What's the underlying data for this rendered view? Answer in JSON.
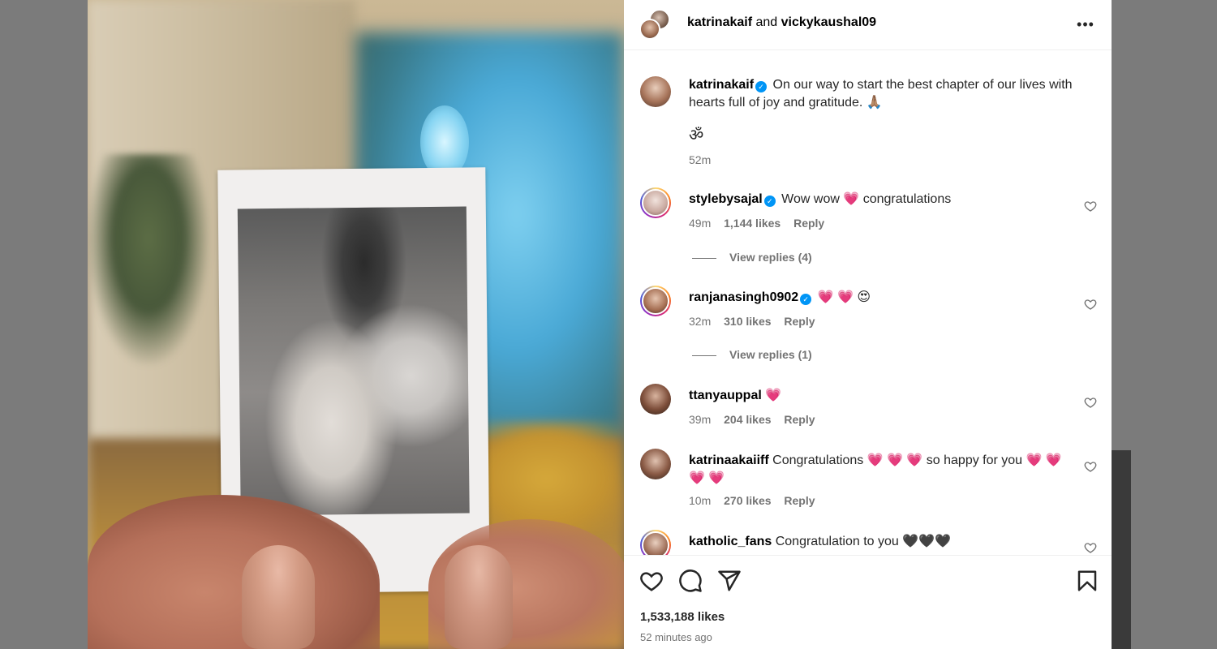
{
  "post": {
    "header": {
      "user1": "katrinakaif",
      "joiner": " and ",
      "user2": "vickykaushal09",
      "more": "•••"
    },
    "caption": {
      "user": "katrinakaif",
      "text": " On our way to start the best chapter of our lives with hearts full of joy and gratitude. 🙏🏽",
      "extra": "ॐ",
      "time": "52m"
    },
    "comments": [
      {
        "user": "stylebysajal",
        "verified": true,
        "text": " Wow wow 💗 congratulations",
        "time": "49m",
        "likes": "1,144 likes",
        "reply": "Reply",
        "view_replies": "View replies (4)"
      },
      {
        "user": "ranjanasingh0902",
        "verified": true,
        "text": " 💗 💗 😍",
        "time": "32m",
        "likes": "310 likes",
        "reply": "Reply",
        "view_replies": "View replies (1)"
      },
      {
        "user": "ttanyauppal",
        "verified": false,
        "text": " 💗",
        "time": "39m",
        "likes": "204 likes",
        "reply": "Reply"
      },
      {
        "user": "katrinaakaiiff",
        "verified": false,
        "text": " Congratulations 💗 💗 💗 so happy for you 💗 💗 💗 💗",
        "time": "10m",
        "likes": "270 likes",
        "reply": "Reply"
      },
      {
        "user": "katholic_fans",
        "verified": false,
        "text": " Congratulation to you 🖤🖤🖤"
      }
    ],
    "likes_total": "1,533,188 likes",
    "time_ago": "52 minutes ago",
    "icons": {
      "like": "heart-outline-icon",
      "comment": "comment-bubble-icon",
      "share": "paper-plane-icon",
      "save": "bookmark-icon",
      "verified": "verified-badge-icon"
    },
    "colors": {
      "verified": "#0095f6",
      "muted_text": "#737373",
      "heart": "#ff3d6e"
    }
  }
}
